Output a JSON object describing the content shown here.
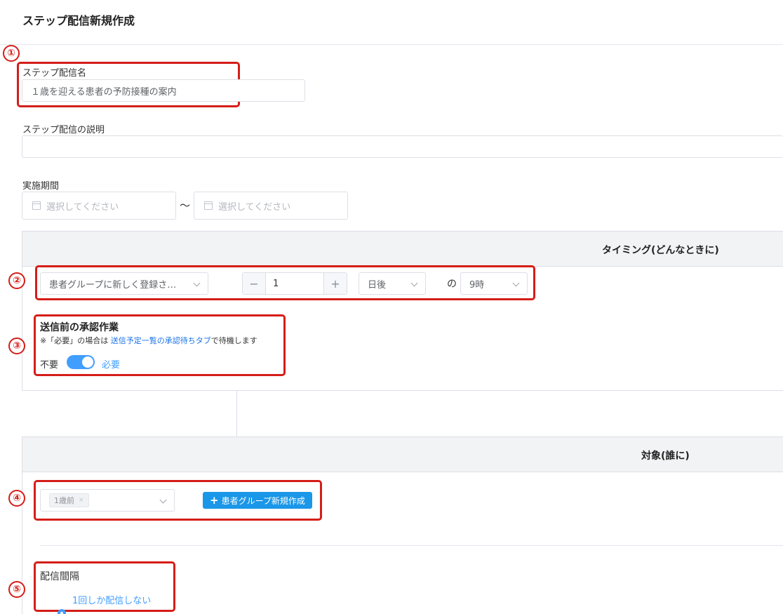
{
  "page": {
    "title": "ステップ配信新規作成"
  },
  "markers": [
    "①",
    "②",
    "③",
    "④",
    "⑤"
  ],
  "step_name": {
    "label": "ステップ配信名",
    "value": "１歳を迎える患者の予防接種の案内"
  },
  "step_description": {
    "label": "ステップ配信の説明",
    "value": ""
  },
  "period": {
    "label": "実施期間",
    "start_placeholder": "選択してください",
    "separator": "〜",
    "end_placeholder": "選択してください"
  },
  "timing": {
    "header": "タイミング(どんなときに)",
    "trigger_select": "患者グループに新しく登録さ…",
    "stepper": {
      "minus": "−",
      "value": "1",
      "plus": "+"
    },
    "unit_select": "日後",
    "no_label": "の",
    "hour_select": "9時"
  },
  "approval": {
    "title": "送信前の承認作業",
    "note_prefix": "※「必要」の場合は ",
    "note_link": "送信予定一覧の承認待ちタブ",
    "note_suffix": "で待機します",
    "off_label": "不要",
    "on_label": "必要",
    "enabled": true
  },
  "target": {
    "header": "対象(誰に)",
    "group_tag": "1歳前",
    "tag_close": "×",
    "new_group_button": "患者グループ新規作成",
    "plus_icon": "+"
  },
  "interval": {
    "label": "配信間隔",
    "option": "1回しか配信しない"
  },
  "colors": {
    "accent": "#409eff",
    "annotation_red": "#d51d18",
    "button_blue": "#1a97e8"
  }
}
